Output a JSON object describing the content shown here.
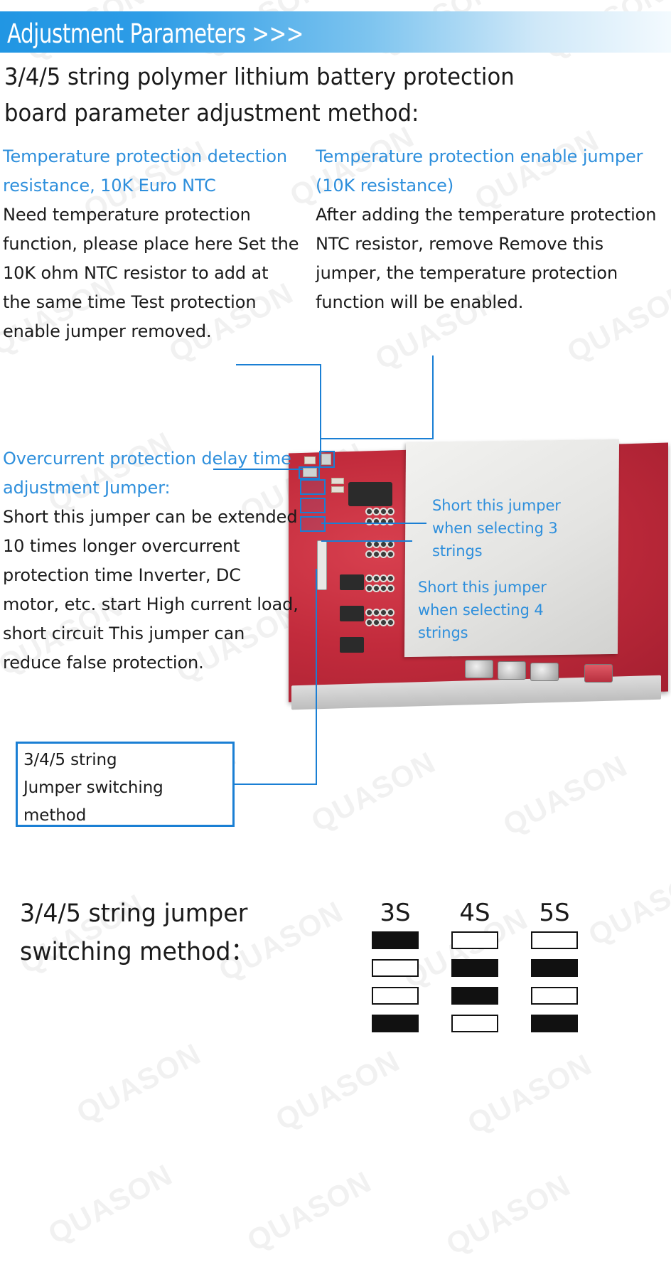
{
  "header": {
    "title": "Adjustment Parameters >>>",
    "bar_color_start": "#2196e3",
    "bar_color_end": "#f3fafe"
  },
  "main_title": {
    "line1": "3/4/5 string polymer lithium battery protection",
    "line2": "board parameter adjustment method:"
  },
  "accent_color": "#2e8fdc",
  "columns": {
    "left": {
      "heading": "Temperature protection detection resistance, 10K Euro NTC",
      "body": "Need temperature protection function, please place here Set the 10K ohm NTC resistor to add at the same time Test protection enable jumper removed."
    },
    "right": {
      "heading": "Temperature protection enable jumper (10K resistance)",
      "body": "After adding the temperature protection NTC resistor, remove Remove this jumper, the temperature protection function will be enabled."
    },
    "overcurrent": {
      "heading": "Overcurrent protection delay time adjustment Jumper:",
      "body": "Short this jumper can be extended 10 times longer overcurrent protection time Inverter, DC motor, etc. start High current load, short circuit This jumper can reduce false protection."
    }
  },
  "note_box": {
    "line1": "3/4/5 string",
    "line2": "Jumper switching",
    "line3": "method",
    "border_color": "#1a7fd4"
  },
  "pcb_callouts": [
    {
      "name": "short-3-strings",
      "line1": "Short this jumper",
      "line2": "when selecting 3",
      "line3": "strings"
    },
    {
      "name": "short-4-strings",
      "line1": "Short this jumper",
      "line2": "when selecting 4",
      "line3": "strings"
    }
  ],
  "bottom": {
    "title_line1": "3/4/5 string jumper",
    "title_line2": "switching method："
  },
  "jumper_table": {
    "columns": [
      "3S",
      "4S",
      "5S"
    ],
    "rows": [
      [
        true,
        false,
        false
      ],
      [
        false,
        true,
        true
      ],
      [
        false,
        true,
        false
      ],
      [
        true,
        false,
        true
      ]
    ]
  },
  "watermark": {
    "text": "QUASON"
  }
}
